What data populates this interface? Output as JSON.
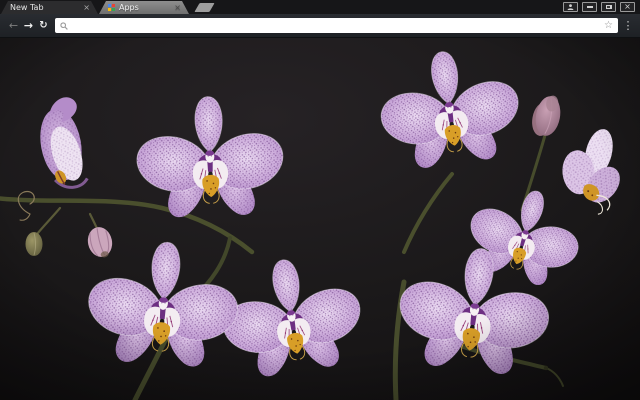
{
  "browser": {
    "tabs": [
      {
        "label": "New Tab",
        "close_glyph": "×",
        "active": true
      },
      {
        "label": "Apps",
        "close_glyph": "×",
        "active": false,
        "favicon": "apps-grid-icon",
        "favicon_colors": [
          "#4285f4",
          "#ea4335",
          "#fbbc05",
          "#34a853"
        ]
      }
    ],
    "new_tab_button": {
      "icon": "new-tab-trapezoid"
    },
    "window_controls": {
      "profile_icon": "person-icon",
      "minimize_icon": "minimize-bar-icon",
      "restore_icon": "overlapping-squares-icon",
      "close_glyph": "×"
    },
    "toolbar": {
      "back_glyph": "←",
      "forward_glyph": "→",
      "reload_glyph": "↻",
      "omnibox": {
        "value": "",
        "search_icon": "magnifier-icon",
        "bookmark_glyph": "☆"
      },
      "menu_glyph": "⋮"
    },
    "theme": {
      "frame": "#161618",
      "toolbar": "#24272c",
      "tab_active": "#2c2c2e",
      "tab_inactive": "#7e7e7e",
      "omnibox_bg": "#ffffff"
    }
  },
  "content": {
    "photo_alt": "Cluster of purple speckled Phalaenopsis moth orchids with buds and dark green stems against a black background",
    "palette": {
      "background": "#1b191a",
      "petal": "#cfb0dd",
      "petal_edge": "#ead9f1",
      "speckle": "#6f3f87",
      "throat_purple": "#6d2f82",
      "lip_white": "#f3ecf1",
      "lip_streak": "#8e2f6e",
      "crest_gold": "#d89e27",
      "crest_spot": "#6b3a10",
      "stem": "#4a4f2d",
      "bud_mauve": "#b388a0",
      "bud_green": "#8f8a63"
    }
  }
}
